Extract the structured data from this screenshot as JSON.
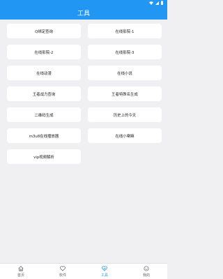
{
  "app": {
    "title": "工具",
    "accent": "#2196f3"
  },
  "status_bar": {
    "icons": [
      "wifi-icon",
      "signal-icon",
      "battery-icon"
    ]
  },
  "tools": [
    {
      "label": "Q绑定查询"
    },
    {
      "label": "在线影院-1"
    },
    {
      "label": "在线影院-2"
    },
    {
      "label": "在线影院-3"
    },
    {
      "label": "在线动漫"
    },
    {
      "label": "在线小说"
    },
    {
      "label": "王者战力查询"
    },
    {
      "label": "王者特殊名生成"
    },
    {
      "label": "二维码生成"
    },
    {
      "label": "历史上的今天"
    },
    {
      "label": "m3u8在线播放器"
    },
    {
      "label": "在线小喇嘛"
    },
    {
      "label": "vip视频解析"
    }
  ],
  "bottom_nav": {
    "items": [
      {
        "label": "首页",
        "icon": "home-icon",
        "active": false
      },
      {
        "label": "软件",
        "icon": "heart-icon",
        "active": false
      },
      {
        "label": "工具",
        "icon": "heart-shield-icon",
        "active": true
      },
      {
        "label": "我的",
        "icon": "smiley-icon",
        "active": false
      }
    ]
  }
}
